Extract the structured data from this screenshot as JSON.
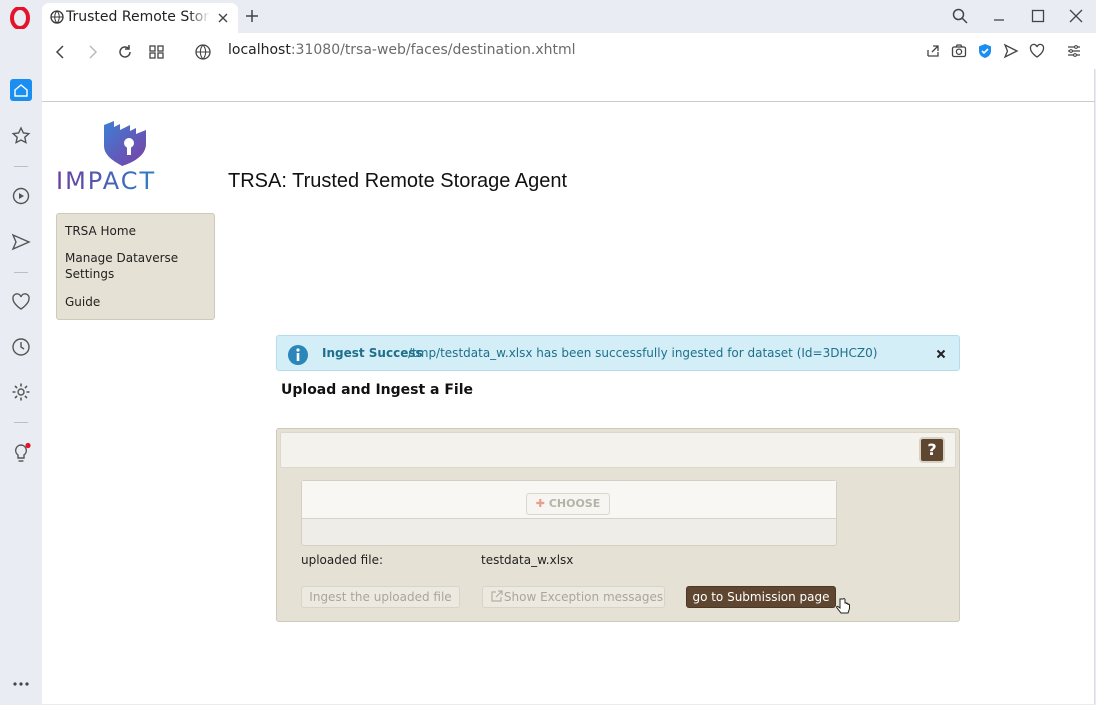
{
  "browser": {
    "tab_title": "Trusted Remote Storage Agent",
    "url_host": "localhost",
    "url_rest": ":31080/trsa-web/faces/destination.xhtml"
  },
  "app": {
    "title": "TRSA: Trusted Remote Storage Agent",
    "logo_text": "IMPACT"
  },
  "menu": {
    "items": [
      "TRSA Home",
      "Manage Dataverse",
      "Settings",
      "Guide"
    ]
  },
  "alert": {
    "summary": "Ingest Success",
    "detail": "/tmp/testdata_w.xlsx has been successfully ingested for dataset (Id=3DHCZ0)"
  },
  "upload": {
    "section_title": "Upload and Ingest a File",
    "help": "?",
    "choose_label": "CHOOSE",
    "uploaded_label": "uploaded file:",
    "uploaded_value": "testdata_w.xlsx",
    "ingest_button": "Ingest the uploaded file",
    "exceptions_button": "Show Exception messages",
    "submission_button": "go to Submission page"
  },
  "colors": {
    "accent": "#5e4630",
    "alert_bg": "#d4eef7",
    "alert_text": "#1e6f8a",
    "panel_bg": "#e6e1d5"
  }
}
